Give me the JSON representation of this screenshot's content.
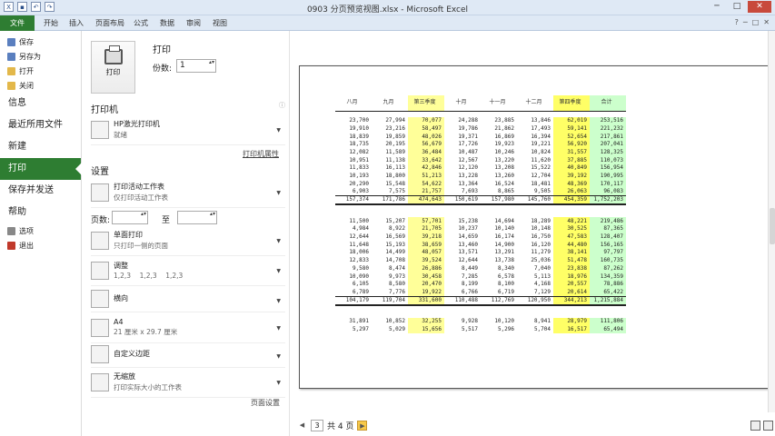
{
  "window": {
    "title": "0903 分页预览视图.xlsx - Microsoft Excel",
    "min": "─",
    "max": "□",
    "close": "✕"
  },
  "ribbon_tabs": [
    "文件",
    "开始",
    "插入",
    "页面布局",
    "公式",
    "数据",
    "审阅",
    "视图"
  ],
  "nav": {
    "small_items": [
      "保存",
      "另存为",
      "打开",
      "关闭"
    ],
    "big_items": [
      "信息",
      "最近所用文件",
      "新建",
      "打印",
      "保存并发送",
      "帮助"
    ],
    "small_items2": [
      "选项",
      "退出"
    ]
  },
  "print": {
    "header": "打印",
    "button_label": "打印",
    "copies_label": "份数:",
    "copies_value": "1",
    "printer_header": "打印机",
    "printer_name": "HP激光打印机",
    "printer_status": "就绪",
    "printer_props": "打印机属性",
    "settings_header": "设置",
    "pages_label": "页数:",
    "to_label": "至",
    "page_setup": "页面设置",
    "settings": [
      {
        "t1": "打印活动工作表",
        "t2": "仅打印活动工作表"
      },
      {
        "t1": "单面打印",
        "t2": "只打印一侧的页面"
      },
      {
        "t1": "调整",
        "t2": "1,2,3    1,2,3    1,2,3"
      },
      {
        "t1": "横向",
        "t2": ""
      },
      {
        "t1": "A4",
        "t2": "21 厘米 x 29.7 厘米"
      },
      {
        "t1": "自定义边距",
        "t2": ""
      },
      {
        "t1": "无缩放",
        "t2": "打印实际大小的工作表"
      }
    ]
  },
  "preview": {
    "headers": [
      "八月",
      "九月",
      "第三季度",
      "十月",
      "十一月",
      "十二月",
      "第四季度",
      "合计"
    ],
    "block1": [
      [
        "23,700",
        "27,994",
        "70,077",
        "24,288",
        "23,885",
        "13,846",
        "62,019",
        "253,516"
      ],
      [
        "19,910",
        "23,216",
        "58,497",
        "19,786",
        "21,862",
        "17,493",
        "59,141",
        "221,232"
      ],
      [
        "18,839",
        "19,859",
        "48,026",
        "19,371",
        "16,869",
        "16,394",
        "52,654",
        "217,861"
      ],
      [
        "18,735",
        "20,195",
        "56,679",
        "17,726",
        "19,923",
        "19,221",
        "56,920",
        "207,041"
      ],
      [
        "12,082",
        "11,589",
        "36,484",
        "10,487",
        "10,246",
        "10,824",
        "31,557",
        "128,325"
      ],
      [
        "10,951",
        "11,138",
        "33,642",
        "12,567",
        "13,220",
        "11,620",
        "37,885",
        "110,073"
      ],
      [
        "11,833",
        "16,113",
        "42,846",
        "12,120",
        "13,208",
        "15,522",
        "40,849",
        "156,954"
      ],
      [
        "10,193",
        "18,800",
        "51,213",
        "13,228",
        "13,260",
        "12,704",
        "39,192",
        "190,995"
      ],
      [
        "20,290",
        "15,548",
        "54,622",
        "13,364",
        "16,524",
        "18,481",
        "48,369",
        "170,117"
      ],
      [
        "6,903",
        "7,575",
        "21,757",
        "7,693",
        "8,865",
        "9,505",
        "26,063",
        "96,083"
      ],
      [
        "157,374",
        "171,786",
        "474,643",
        "150,619",
        "157,980",
        "145,760",
        "454,359",
        "1,752,203"
      ]
    ],
    "block2": [
      [
        "11,500",
        "15,207",
        "57,701",
        "15,238",
        "14,694",
        "18,289",
        "48,221",
        "219,486"
      ],
      [
        "4,984",
        "8,922",
        "21,705",
        "10,237",
        "10,140",
        "10,148",
        "30,525",
        "87,365"
      ],
      [
        "12,644",
        "16,569",
        "39,218",
        "14,659",
        "16,174",
        "16,750",
        "47,583",
        "128,407"
      ],
      [
        "11,648",
        "15,193",
        "38,659",
        "13,460",
        "14,900",
        "16,120",
        "44,480",
        "156,165"
      ],
      [
        "18,006",
        "14,499",
        "48,057",
        "13,571",
        "13,291",
        "11,279",
        "38,141",
        "97,797"
      ],
      [
        "12,833",
        "14,708",
        "39,524",
        "12,644",
        "13,738",
        "25,036",
        "51,478",
        "160,735"
      ],
      [
        "9,580",
        "8,474",
        "26,886",
        "8,449",
        "8,340",
        "7,040",
        "23,838",
        "87,262"
      ],
      [
        "10,090",
        "9,973",
        "30,458",
        "7,285",
        "6,578",
        "5,113",
        "18,976",
        "134,359"
      ],
      [
        "6,105",
        "8,580",
        "20,470",
        "8,199",
        "8,100",
        "4,168",
        "20,557",
        "78,886"
      ],
      [
        "6,789",
        "7,776",
        "19,922",
        "6,766",
        "6,719",
        "7,129",
        "20,614",
        "65,422"
      ],
      [
        "104,179",
        "119,704",
        "331,600",
        "110,488",
        "112,769",
        "120,950",
        "344,213",
        "1,215,884"
      ]
    ],
    "block3": [
      [
        "31,891",
        "10,852",
        "32,255",
        "9,928",
        "10,120",
        "8,941",
        "28,979",
        "111,806"
      ],
      [
        "5,297",
        "5,029",
        "15,656",
        "5,517",
        "5,296",
        "5,704",
        "16,517",
        "65,494"
      ]
    ],
    "current_page": "3",
    "page_total": "共 4 页",
    "prev": "◀",
    "next": "▶"
  },
  "colors": {
    "file_tab": "#2e7d32",
    "quarter_col": "#ffff99",
    "total_col": "#ccffcc"
  }
}
